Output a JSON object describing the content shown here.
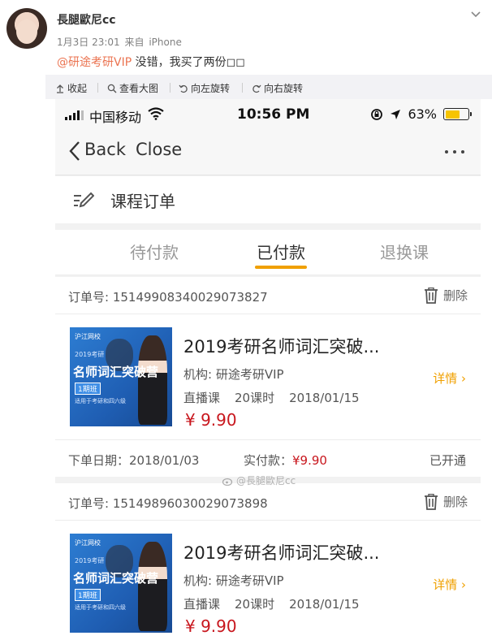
{
  "post": {
    "username": "長腿歐尼cc",
    "date": "1月3日 23:01",
    "source_prefix": "来自",
    "source": "iPhone",
    "mention": "@研途考研VIP",
    "text": " 没错，我买了两份◻◻"
  },
  "actions": [
    {
      "label": "收起",
      "icon": "collapse-icon"
    },
    {
      "label": "查看大图",
      "icon": "magnifier-icon"
    },
    {
      "label": "向左旋转",
      "icon": "rotate-left-icon"
    },
    {
      "label": "向右旋转",
      "icon": "rotate-right-icon"
    }
  ],
  "phone": {
    "status": {
      "carrier": "中国移动",
      "time": "10:56 PM",
      "battery": "63%",
      "battery_level": 0.63
    },
    "nav": {
      "back": "Back",
      "close": "Close"
    },
    "page_title": "课程订单",
    "tabs": [
      {
        "label": "待付款",
        "active": false
      },
      {
        "label": "已付款",
        "active": true
      },
      {
        "label": "退换课",
        "active": false
      }
    ],
    "orders": [
      {
        "order_no": "订单号: 15149908340029073827",
        "delete": "删除",
        "thumb": {
          "logo": "沪江网校",
          "year": "2019考研",
          "title": "名师词汇突破营",
          "badge": "1期班",
          "sub": "适用于考研和四六级"
        },
        "title": "2019考研名师词汇突破...",
        "org": "机构: 研途考研VIP",
        "type": "直播课",
        "lessons": "20课时",
        "date": "2018/01/15",
        "price": "¥ 9.90",
        "detail": "详情 ›",
        "order_date": "下单日期：2018/01/03",
        "paid_label": "实付款：",
        "paid_amount": "¥9.90",
        "status": "已开通"
      },
      {
        "order_no": "订单号: 15149896030029073898",
        "delete": "删除",
        "thumb": {
          "logo": "沪江网校",
          "year": "2019考研",
          "title": "名师词汇突破营",
          "badge": "1期班",
          "sub": "适用于考研和四六级"
        },
        "title": "2019考研名师词汇突破...",
        "org": "机构: 研途考研VIP",
        "type": "直播课",
        "lessons": "20课时",
        "date": "2018/01/15",
        "price": "¥ 9.90",
        "detail": "详情 ›"
      }
    ],
    "watermark": "@長腿歐尼cc"
  },
  "colors": {
    "mention": "#eb7350",
    "accent": "#f0a000",
    "price": "#c8161d",
    "battery": "#f6c400"
  }
}
